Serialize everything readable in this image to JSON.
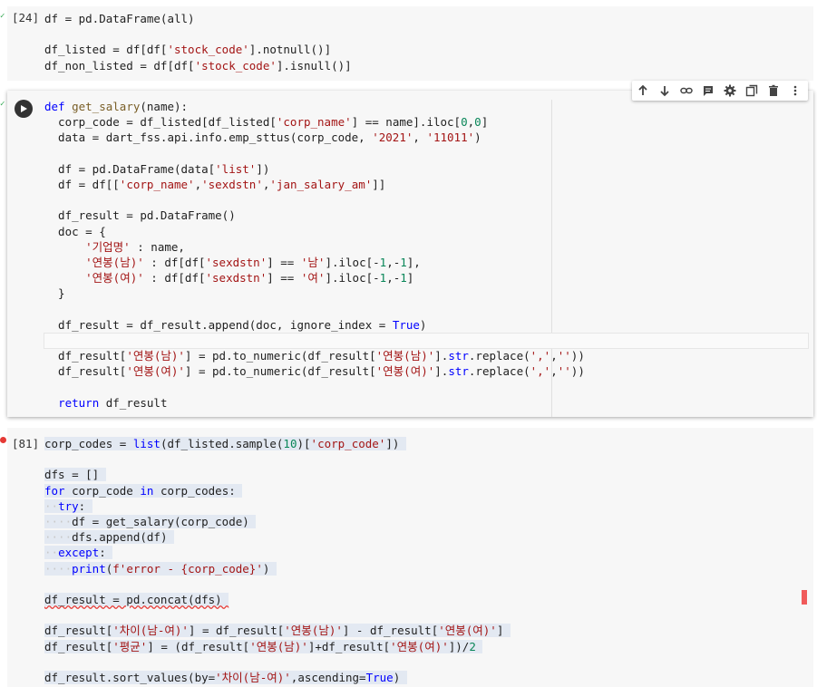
{
  "cells": [
    {
      "exec_count": "[24]",
      "lines": [
        "df = pd.DataFrame(all)",
        "",
        "df_listed = df[df['stock_code'].notnull()]",
        "df_non_listed = df[df['stock_code'].isnull()]"
      ]
    },
    {
      "exec_count": "",
      "lines": [
        "def get_salary(name):",
        "  corp_code = df_listed[df_listed['corp_name'] == name].iloc[0,0]",
        "  data = dart_fss.api.info.emp_sttus(corp_code, '2021', '11011')",
        "",
        "  df = pd.DataFrame(data['list'])",
        "  df = df[['corp_name','sexdstn','jan_salary_am']]",
        "",
        "  df_result = pd.DataFrame()",
        "  doc = {",
        "      '기업명' : name,",
        "      '연봉(남)' : df[df['sexdstn'] == '남'].iloc[-1,-1],",
        "      '연봉(여)' : df[df['sexdstn'] == '여'].iloc[-1,-1]",
        "  }",
        "",
        "  df_result = df_result.append(doc, ignore_index = True)",
        "",
        "  df_result['연봉(남)'] = pd.to_numeric(df_result['연봉(남)'].str.replace(',',''))",
        "  df_result['연봉(여)'] = pd.to_numeric(df_result['연봉(여)'].str.replace(',',''))",
        "",
        "  return df_result"
      ]
    },
    {
      "exec_count": "[81]",
      "lines": [
        "corp_codes = list(df_listed.sample(10)['corp_code'])",
        "",
        "dfs = []",
        "for corp_code in corp_codes:",
        "  try:",
        "    df = get_salary(corp_code)",
        "    dfs.append(df)",
        "  except:",
        "    print(f'error - {corp_code}')",
        "",
        "df_result = pd.concat(dfs)",
        "",
        "df_result['차이(남-여)'] = df_result['연봉(남)'] - df_result['연봉(여)']",
        "df_result['평균'] = (df_result['연봉(남)']+df_result['연봉(여)'])/2",
        "",
        "df_result.sort_values(by='차이(남-여)',ascending=True)"
      ]
    }
  ],
  "toolbar_icons": [
    "move-up-icon",
    "move-down-icon",
    "link-icon",
    "comment-icon",
    "settings-icon",
    "mirror-cell-icon",
    "delete-icon",
    "more-icon"
  ],
  "colors": {
    "keyword": "#0000ff",
    "string": "#a31515",
    "number": "#098658",
    "cell_bg": "#f7f7f7",
    "error_dot": "#e53935",
    "ok_check": "#34a853"
  }
}
